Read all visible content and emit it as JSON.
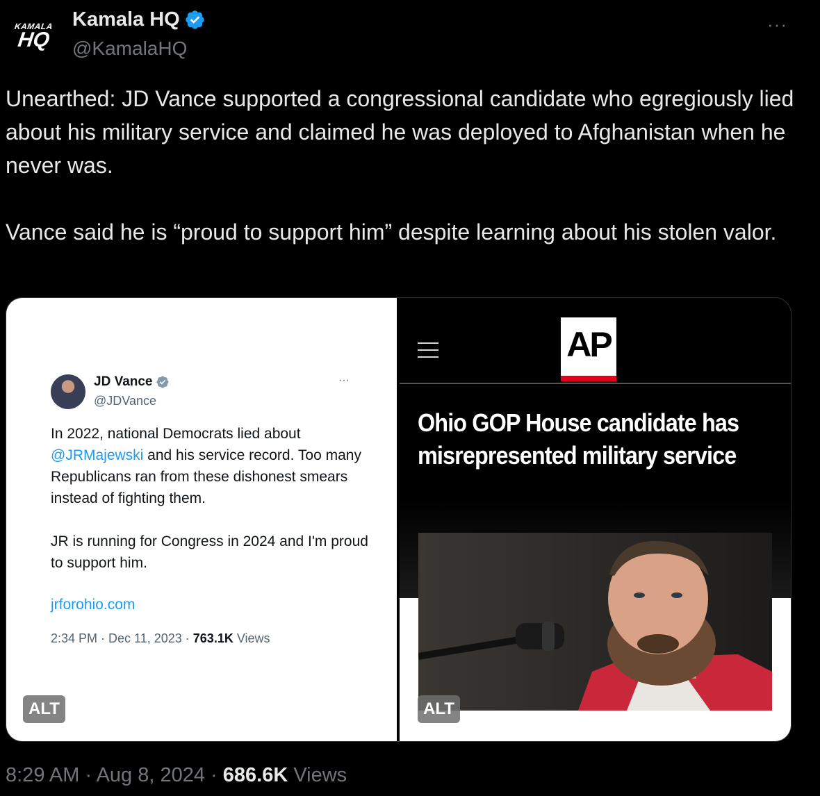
{
  "tweet": {
    "avatar_text_top": "KAMALA",
    "avatar_text_bottom": "HQ",
    "display_name": "Kamala HQ",
    "handle": "@KamalaHQ",
    "verified_icon": "verified-badge-icon",
    "more_label": "···",
    "text": "Unearthed: JD Vance supported a congressional candidate who egregiously lied about his military service and claimed he was deployed to Afghanistan when he never was.\n\nVance said he is “proud to support him” despite learning about his stolen valor.",
    "time": "8:29 AM",
    "sep1": " · ",
    "date": "Aug 8, 2024",
    "sep2": " · ",
    "views_count": "686.6K",
    "views_label": " Views"
  },
  "embedded_tweet": {
    "display_name": "JD Vance",
    "handle": "@JDVance",
    "more_label": "···",
    "line1_pre": "In 2022, national Democrats lied about ",
    "mention": "@JRMajewski",
    "line1_post": " and his service record. Too many Republicans ran from these dishonest smears instead of fighting them.",
    "paragraph2": "JR is running for Congress in 2024 and I'm proud to support him.",
    "link": "jrforohio.com",
    "meta_time": "2:34 PM · Dec 11, 2023 · ",
    "meta_views_count": "763.1K",
    "meta_views_label": " Views",
    "alt_badge": "ALT"
  },
  "ap_article": {
    "logo": "AP",
    "headline": "Ohio GOP House candidate has misrepresented military service",
    "alt_badge": "ALT"
  },
  "colors": {
    "background": "#000000",
    "text": "#e7e9ea",
    "muted": "#71767b",
    "link": "#1d9bf0",
    "ap_red": "#e2001a"
  }
}
